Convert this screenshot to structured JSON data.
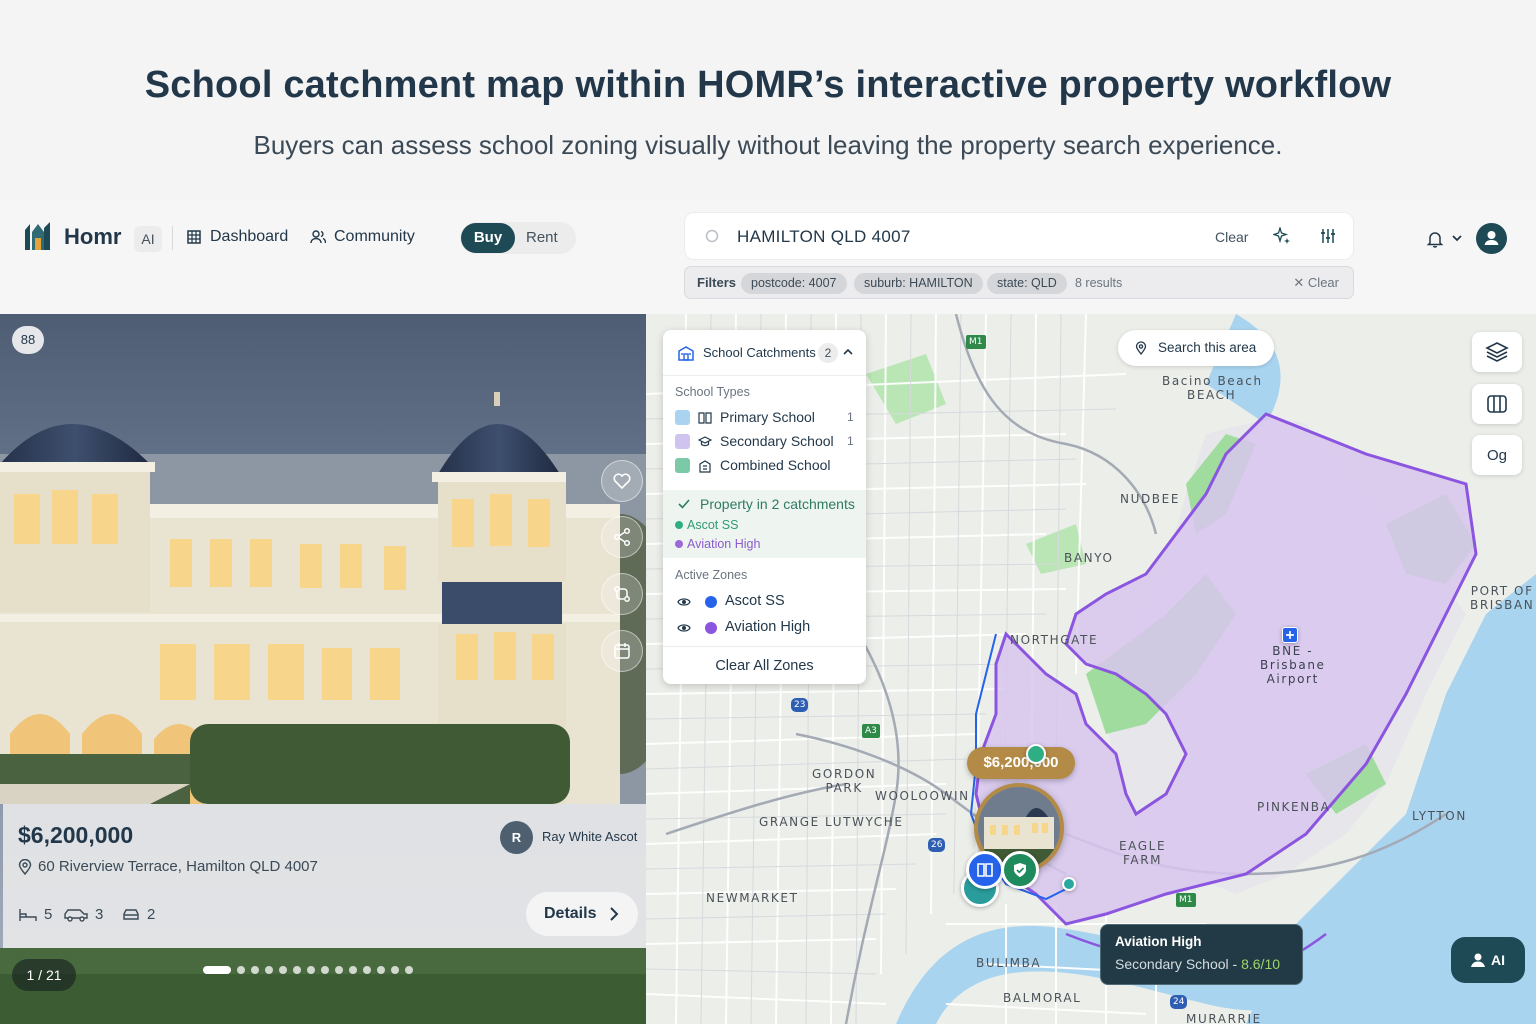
{
  "hero": {
    "title": "School catchment map within HOMR’s interactive property workflow",
    "subtitle": "Buyers can assess school zoning visually without leaving the property search experience."
  },
  "nav": {
    "brand": "Homr",
    "ai_chip": "AI",
    "links": [
      "Dashboard",
      "Community"
    ],
    "toggle": {
      "active": "Buy",
      "inactive": "Rent"
    }
  },
  "search": {
    "query": "HAMILTON QLD 4007",
    "clear_label": "Clear",
    "filters_label": "Filters",
    "chips": [
      "postcode: 4007",
      "suburb: HAMILTON",
      "state: QLD"
    ],
    "results": "8 results",
    "filters_clear": "Clear"
  },
  "listing": {
    "gallery_count": "88",
    "price": "$6,200,000",
    "address": "60 Riverview Terrace, Hamilton QLD 4007",
    "agent_initial": "R",
    "agent": "Ray White Ascot",
    "beds": "5",
    "cars": "3",
    "baths": "2",
    "details_label": "Details",
    "pager": "1 / 21",
    "dot_count": 14
  },
  "catchments": {
    "title": "School Catchments",
    "count": "2",
    "types_label": "School Types",
    "types": [
      {
        "name": "Primary School",
        "count": "1",
        "color": "#a9d3ee"
      },
      {
        "name": "Secondary School",
        "count": "1",
        "color": "#cfc3f0"
      },
      {
        "name": "Combined School",
        "count": "",
        "color": "#7cc9a7"
      }
    ],
    "property_status": "Property in 2 catchments",
    "property_schools": [
      {
        "name": "Ascot SS",
        "color": "#2fae84"
      },
      {
        "name": "Aviation High",
        "color": "#9a6ad8"
      }
    ],
    "zones_label": "Active Zones",
    "zones": [
      {
        "name": "Ascot SS",
        "color": "#2563eb"
      },
      {
        "name": "Aviation High",
        "color": "#8b55e0"
      }
    ],
    "clear_all": "Clear All Zones"
  },
  "map": {
    "search_area": "Search this area",
    "tool_og": "Og",
    "price_tag": "$6,200,000",
    "labels": {
      "sandgate": "Bacino Beach",
      "beach": "BEACH",
      "nudgee": "NUDBEE",
      "banyo": "BANYO",
      "northgate": "NORTHGATE",
      "airport": "BNE -\nBrisbane\nAirport",
      "port": "PORT OF\nBRISBAN",
      "gordon": "GORDON\nPARK",
      "wooloowin": "WOOLOOWIN",
      "grange": "GRANGE",
      "lutwyche": "LUTWYCHE",
      "pinkenba": "PINKENBA",
      "lytton": "LYTTON",
      "eagle": "EAGLE\nFARM",
      "newmarket": "NEWMARKET",
      "bulimba": "BULIMBA",
      "balmoral": "BALMORAL",
      "murarrie": "MURARRIE",
      "road_m1": "M1",
      "road_a3": "A3",
      "road_23": "23",
      "road_26": "26",
      "road_24": "24",
      "road_m1b": "M1"
    },
    "tooltip": {
      "school": "Aviation High",
      "type": "Secondary School",
      "separator": "-",
      "rating": "8.6/10"
    },
    "ai_button": "AI"
  },
  "colors": {
    "brand": "#1d4a55",
    "price_gold": "#b38a46",
    "zone_purple": "#8b55e0",
    "zone_fill": "#d9c8ef",
    "water": "#a9d4ef",
    "park": "#9fdc9d"
  }
}
